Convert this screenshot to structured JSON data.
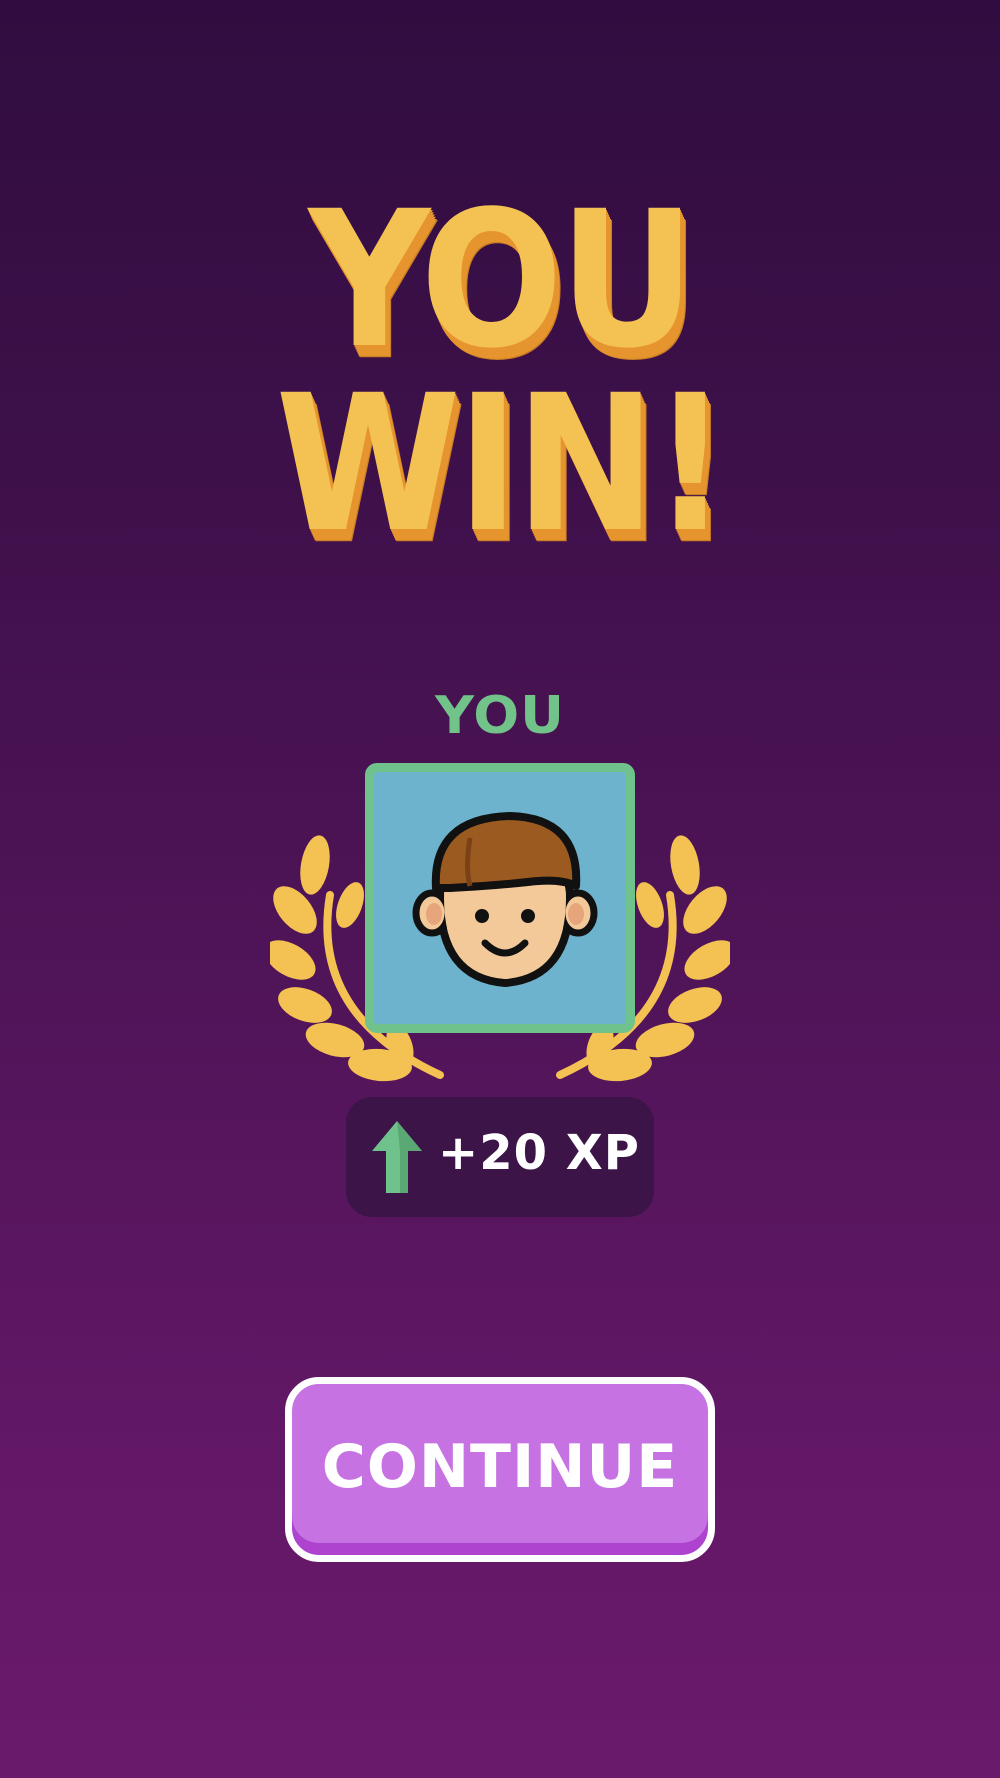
{
  "screen": {
    "title_line1": "YOU",
    "title_line2": "WIN!"
  },
  "player": {
    "label": "YOU",
    "avatar_icon": "smiling-boy-face-icon"
  },
  "reward": {
    "icon": "green-up-arrow-icon",
    "text": "+20 XP"
  },
  "actions": {
    "continue_label": "CONTINUE"
  },
  "colors": {
    "background_top": "#300d40",
    "background_bottom": "#6a1a6a",
    "title_gold": "#f4c153",
    "title_shadow": "#e6952e",
    "player_green": "#72c38a",
    "avatar_bg": "#6db3cd",
    "button_purple": "#c672e3"
  }
}
